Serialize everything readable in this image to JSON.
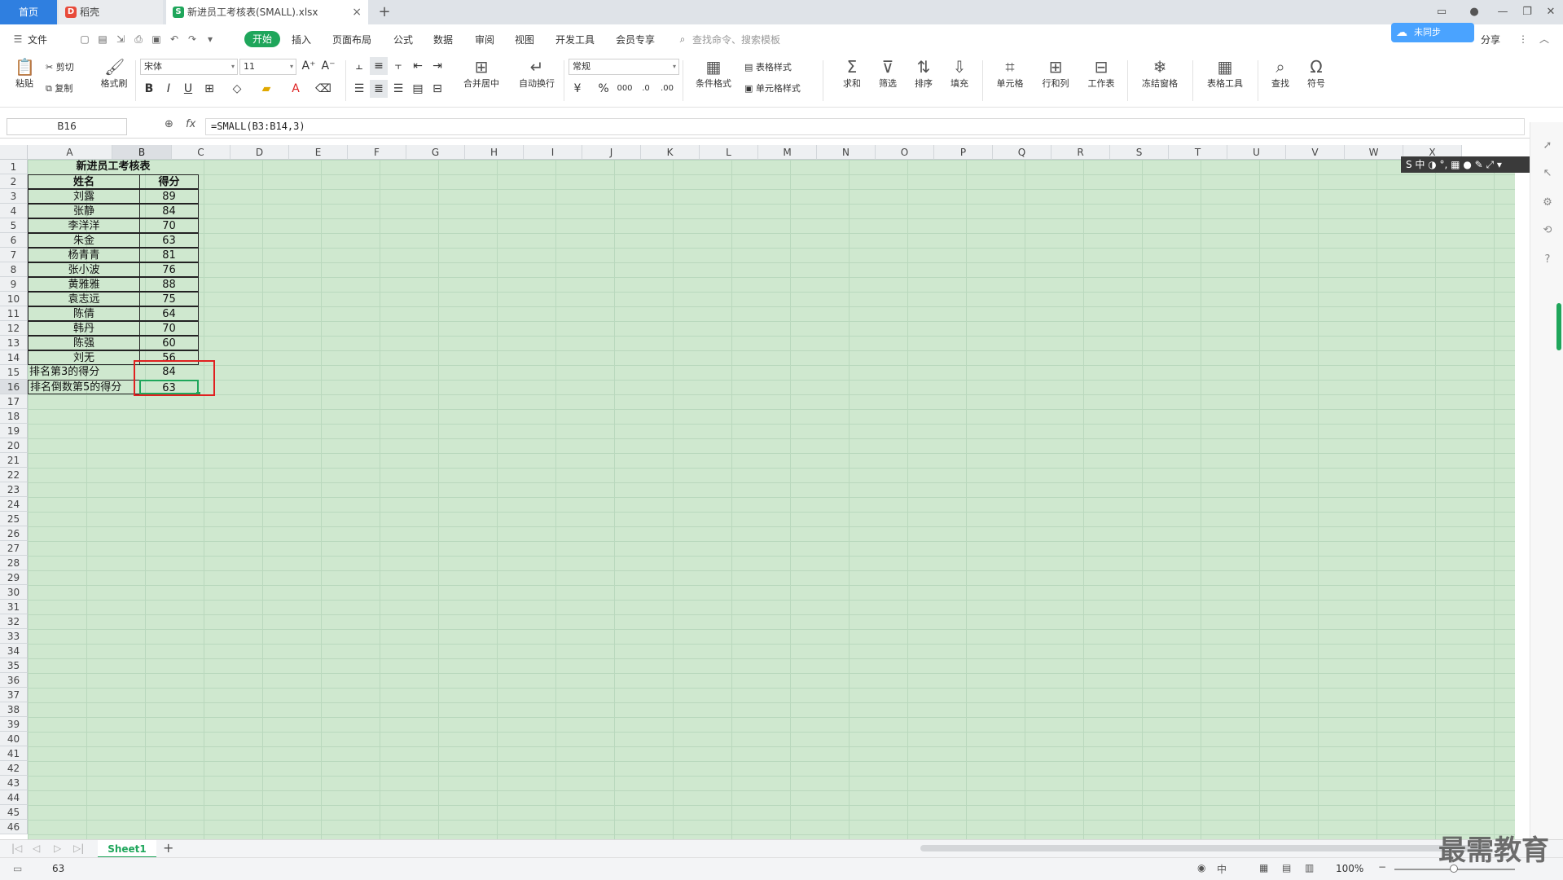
{
  "tabs": {
    "home": "首页",
    "docer": "稻壳",
    "file": "新进员工考核表(SMALL).xlsx"
  },
  "menu": {
    "file": "文件",
    "items": [
      "开始",
      "插入",
      "页面布局",
      "公式",
      "数据",
      "审阅",
      "视图",
      "开发工具",
      "会员专享"
    ],
    "search": "查找命令、搜索模板",
    "sync": "未同步",
    "share": "分享"
  },
  "ribbon": {
    "paste": "粘贴",
    "cut": "剪切",
    "copy": "复制",
    "format_painter": "格式刷",
    "font": "宋体",
    "font_size": "11",
    "merge": "合并居中",
    "wrap": "自动换行",
    "number_format": "常规",
    "cond_format": "条件格式",
    "table_style": "表格样式",
    "cell_style": "单元格样式",
    "sum": "求和",
    "filter": "筛选",
    "sort": "排序",
    "fill": "填充",
    "cells": "单元格",
    "row_col": "行和列",
    "worksheet": "工作表",
    "freeze": "冻结窗格",
    "table_tools": "表格工具",
    "find": "查找",
    "symbol": "符号"
  },
  "formula_bar": {
    "name_box": "B16",
    "fx": "fx",
    "formula": "=SMALL(B3:B14,3)"
  },
  "columns": [
    "A",
    "B",
    "C",
    "D",
    "E",
    "F",
    "G",
    "H",
    "I",
    "J",
    "K",
    "L",
    "M",
    "N",
    "O",
    "P",
    "Q",
    "R",
    "S",
    "T",
    "U",
    "V",
    "W",
    "X"
  ],
  "rows": [
    "1",
    "2",
    "3",
    "4",
    "5",
    "6",
    "7",
    "8",
    "9",
    "10",
    "11",
    "12",
    "13",
    "14",
    "15",
    "16",
    "17",
    "18",
    "19",
    "20",
    "21",
    "22",
    "23",
    "24",
    "25",
    "26",
    "27",
    "28",
    "29",
    "30",
    "31",
    "32",
    "33",
    "34",
    "35",
    "36",
    "37",
    "38",
    "39",
    "40",
    "41",
    "42",
    "43",
    "44",
    "45",
    "46"
  ],
  "sheet": {
    "title": "新进员工考核表",
    "header": [
      "姓名",
      "得分"
    ],
    "data": [
      [
        "刘露",
        "89"
      ],
      [
        "张静",
        "84"
      ],
      [
        "李洋洋",
        "70"
      ],
      [
        "朱金",
        "63"
      ],
      [
        "杨青青",
        "81"
      ],
      [
        "张小波",
        "76"
      ],
      [
        "黄雅雅",
        "88"
      ],
      [
        "袁志远",
        "75"
      ],
      [
        "陈倩",
        "64"
      ],
      [
        "韩丹",
        "70"
      ],
      [
        "陈强",
        "60"
      ],
      [
        "刘无",
        "56"
      ]
    ],
    "summary": [
      [
        "排名第3的得分",
        "84"
      ],
      [
        "排名倒数第5的得分",
        "63"
      ]
    ]
  },
  "sheet_tabs": [
    "Sheet1"
  ],
  "status": {
    "value": "63",
    "zoom": "100%",
    "ime": "中"
  },
  "ime_bar": "S 中 ◑ °, ▦ ● ✎ ⤢ ▾",
  "watermark": "最需教育",
  "colors": {
    "accent": "#1fa65b",
    "tab_home": "#2f7fe0",
    "grid_bg": "#cfe8cf",
    "highlight": "#e02020"
  }
}
